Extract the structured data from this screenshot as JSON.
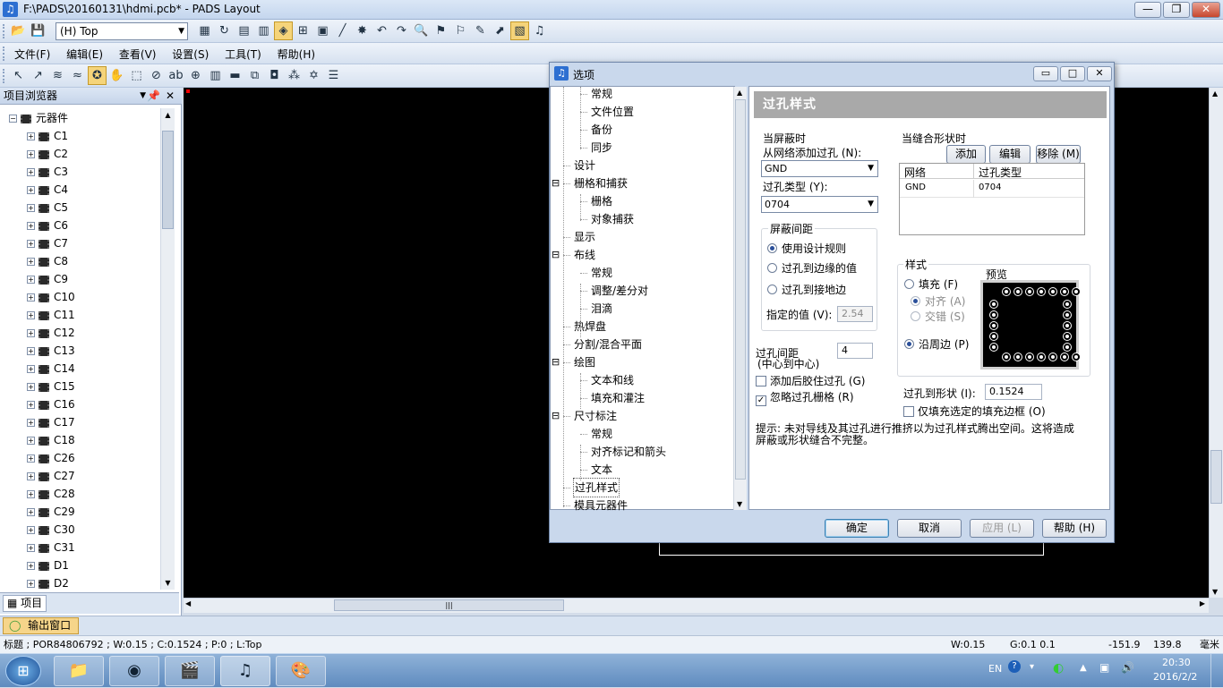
{
  "window": {
    "title": "F:\\PADS\\20160131\\hdmi.pcb* - PADS Layout",
    "minimize": "—",
    "restore": "❐",
    "close": "✕"
  },
  "toolbar": {
    "layer": "(H) Top"
  },
  "menu": [
    "文件(F)",
    "编辑(E)",
    "查看(V)",
    "设置(S)",
    "工具(T)",
    "帮助(H)"
  ],
  "project_browser": {
    "title": "项目浏览器",
    "root": "元器件",
    "items": [
      "C1",
      "C2",
      "C3",
      "C4",
      "C5",
      "C6",
      "C7",
      "C8",
      "C9",
      "C10",
      "C11",
      "C12",
      "C13",
      "C14",
      "C15",
      "C16",
      "C17",
      "C18",
      "C26",
      "C27",
      "C28",
      "C29",
      "C30",
      "C31",
      "D1",
      "D2"
    ],
    "tab": "项目"
  },
  "output_window": {
    "label": "输出窗口"
  },
  "status": {
    "left": "标题 ; POR84806792 ; W:0.15 ; C:0.1524 ; P:0 ; L:Top",
    "w": "W:0.15",
    "g": "G:0.1 0.1",
    "x": "-151.9",
    "y": "139.8",
    "unit": "毫米"
  },
  "taskbar": {
    "lang": "EN",
    "time": "20:30",
    "date": "2016/2/2"
  },
  "dialog": {
    "title": "选项",
    "nav": [
      {
        "label": "常规",
        "level": 2
      },
      {
        "label": "文件位置",
        "level": 2
      },
      {
        "label": "备份",
        "level": 2
      },
      {
        "label": "同步",
        "level": 2
      },
      {
        "label": "设计",
        "level": 1
      },
      {
        "label": "栅格和捕获",
        "level": 1,
        "expander": "⊟"
      },
      {
        "label": "栅格",
        "level": 2
      },
      {
        "label": "对象捕获",
        "level": 2
      },
      {
        "label": "显示",
        "level": 1
      },
      {
        "label": "布线",
        "level": 1,
        "expander": "⊟"
      },
      {
        "label": "常规",
        "level": 2
      },
      {
        "label": "调整/差分对",
        "level": 2
      },
      {
        "label": "泪滴",
        "level": 2
      },
      {
        "label": "热焊盘",
        "level": 1
      },
      {
        "label": "分割/混合平面",
        "level": 1
      },
      {
        "label": "绘图",
        "level": 1,
        "expander": "⊟"
      },
      {
        "label": "文本和线",
        "level": 2
      },
      {
        "label": "填充和灌注",
        "level": 2
      },
      {
        "label": "尺寸标注",
        "level": 1,
        "expander": "⊟"
      },
      {
        "label": "常规",
        "level": 2
      },
      {
        "label": "对齐标记和箭头",
        "level": 2
      },
      {
        "label": "文本",
        "level": 2
      },
      {
        "label": "过孔样式",
        "level": 1,
        "selected": true
      },
      {
        "label": "模具元器件",
        "level": 1
      }
    ],
    "section_title": "过孔样式",
    "shield": {
      "title": "当屏蔽时",
      "from_net_label": "从网络添加过孔 (N):",
      "net_value": "GND",
      "via_type_label": "过孔类型 (Y):",
      "via_type_value": "0704",
      "spacing_group": "屏蔽间距",
      "opt1": "使用设计规则",
      "opt2": "过孔到边缘的值",
      "opt3": "过孔到接地边",
      "specified_label": "指定的值 (V):",
      "specified_value": "2.54",
      "via_spacing_label": "过孔间距",
      "via_spacing_sub": "(中心到中心)",
      "via_spacing_value": "4",
      "add_after_label": "添加后胶住过孔 (G)",
      "ignore_grid_label": "忽略过孔栅格 (R)"
    },
    "stitch": {
      "title": "当缝合形状时",
      "add_btn": "添加 (D)",
      "edit_btn": "编辑 (E)",
      "remove_btn": "移除 (M)",
      "col_net": "网络",
      "col_via": "过孔类型",
      "rows": [
        {
          "net": "GND",
          "via": "0704"
        }
      ]
    },
    "style": {
      "title": "样式",
      "fill": "填充 (F)",
      "align": "对齐 (A)",
      "stagger": "交错 (S)",
      "along_edge": "沿周边 (P)",
      "preview_label": "预览",
      "via_to_shape_label": "过孔到形状 (I):",
      "via_to_shape_value": "0.1524",
      "only_selected_label": "仅填充选定的填充边框 (O)"
    },
    "hint": "提示: 未对导线及其过孔进行推挤以为过孔样式腾出空间。这将造成\n屏蔽或形状缝合不完整。",
    "ok": "确定",
    "cancel": "取消",
    "apply": "应用 (L)",
    "help": "帮助 (H)"
  }
}
